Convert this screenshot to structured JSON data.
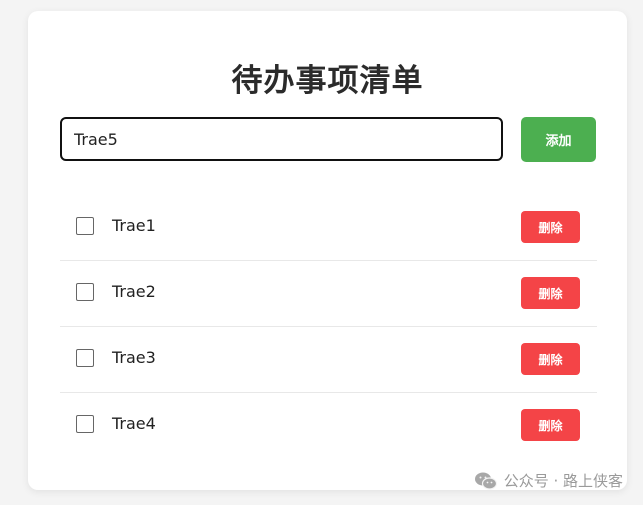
{
  "app": {
    "title": "待办事项清单"
  },
  "input": {
    "value": "Trae5"
  },
  "add_button": {
    "label": "添加"
  },
  "todos": [
    {
      "text": "Trae1",
      "checked": false,
      "delete_label": "删除"
    },
    {
      "text": "Trae2",
      "checked": false,
      "delete_label": "删除"
    },
    {
      "text": "Trae3",
      "checked": false,
      "delete_label": "删除"
    },
    {
      "text": "Trae4",
      "checked": false,
      "delete_label": "删除"
    }
  ],
  "watermark": {
    "icon": "wechat-icon",
    "text": "公众号 · 路上侠客"
  },
  "colors": {
    "add_button": "#4caf50",
    "delete_button": "#f44447",
    "input_border": "#111111"
  }
}
